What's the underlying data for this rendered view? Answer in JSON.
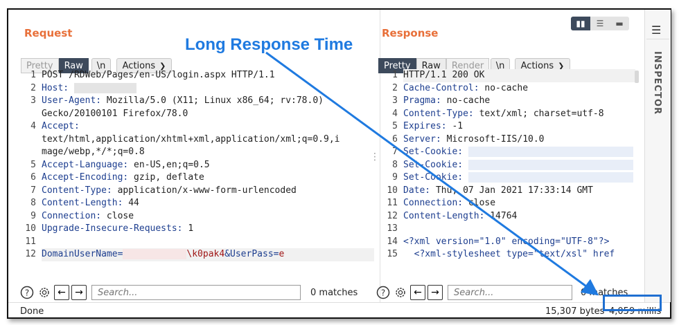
{
  "annotation": {
    "title": "Long Response Time"
  },
  "request": {
    "title": "Request",
    "tabs": [
      "Pretty",
      "Raw",
      "\\n"
    ],
    "actions_label": "Actions",
    "lines": [
      {
        "n": "1",
        "key": "",
        "text": "POST /RDWeb/Pages/en-US/login.aspx HTTP/1.1"
      },
      {
        "n": "2",
        "key": "Host:",
        "text": ""
      },
      {
        "n": "3",
        "key": "User-Agent:",
        "text": " Mozilla/5.0 (X11; Linux x86_64; rv:78.0)"
      },
      {
        "n": "",
        "key": "",
        "text": "Gecko/20100101 Firefox/78.0"
      },
      {
        "n": "4",
        "key": "Accept:",
        "text": ""
      },
      {
        "n": "",
        "key": "",
        "text": "text/html,application/xhtml+xml,application/xml;q=0.9,i"
      },
      {
        "n": "",
        "key": "",
        "text": "mage/webp,*/*;q=0.8"
      },
      {
        "n": "5",
        "key": "Accept-Language:",
        "text": " en-US,en;q=0.5"
      },
      {
        "n": "6",
        "key": "Accept-Encoding:",
        "text": " gzip, deflate"
      },
      {
        "n": "7",
        "key": "Content-Type:",
        "text": " application/x-www-form-urlencoded"
      },
      {
        "n": "8",
        "key": "Content-Length:",
        "text": " 44"
      },
      {
        "n": "9",
        "key": "Connection:",
        "text": " close"
      },
      {
        "n": "10",
        "key": "Upgrade-Insecure-Requests:",
        "text": " 1"
      },
      {
        "n": "11",
        "key": "",
        "text": ""
      },
      {
        "n": "12",
        "key": "DomainUserName=",
        "text": ""
      }
    ],
    "line12_tail": "\\k0pak4",
    "line12_param": "&UserPass=",
    "line12_val": "e",
    "search_placeholder": "Search...",
    "matches": "0 matches"
  },
  "response": {
    "title": "Response",
    "tabs": [
      "Pretty",
      "Raw",
      "Render",
      "\\n"
    ],
    "actions_label": "Actions",
    "lines": [
      {
        "n": "1",
        "key": "",
        "text": "HTTP/1.1 200 OK"
      },
      {
        "n": "2",
        "key": "Cache-Control:",
        "text": " no-cache"
      },
      {
        "n": "3",
        "key": "Pragma:",
        "text": " no-cache"
      },
      {
        "n": "4",
        "key": "Content-Type:",
        "text": " text/xml; charset=utf-8"
      },
      {
        "n": "5",
        "key": "Expires:",
        "text": " -1"
      },
      {
        "n": "6",
        "key": "Server:",
        "text": " Microsoft-IIS/10.0"
      },
      {
        "n": "7",
        "key": "Set-Cookie:",
        "text": ""
      },
      {
        "n": "8",
        "key": "Set-Cookie:",
        "text": ""
      },
      {
        "n": "9",
        "key": "Set-Cookie:",
        "text": ""
      },
      {
        "n": "10",
        "key": "Date:",
        "text": " Thu, 07 Jan 2021 17:33:14 GMT"
      },
      {
        "n": "11",
        "key": "Connection:",
        "text": " close"
      },
      {
        "n": "12",
        "key": "Content-Length:",
        "text": " 14764"
      },
      {
        "n": "13",
        "key": "",
        "text": ""
      }
    ],
    "xml_line14": "<?xml version=\"1.0\" encoding=\"UTF-8\"?>",
    "xml_line15": "  <?xml-stylesheet type=\"text/xsl\" href",
    "search_placeholder": "Search...",
    "matches": "0 matches"
  },
  "inspector": {
    "label": "INSPECTOR"
  },
  "status": {
    "left": "Done",
    "bytes": "15,307 bytes",
    "millis": "4,059 millis"
  }
}
